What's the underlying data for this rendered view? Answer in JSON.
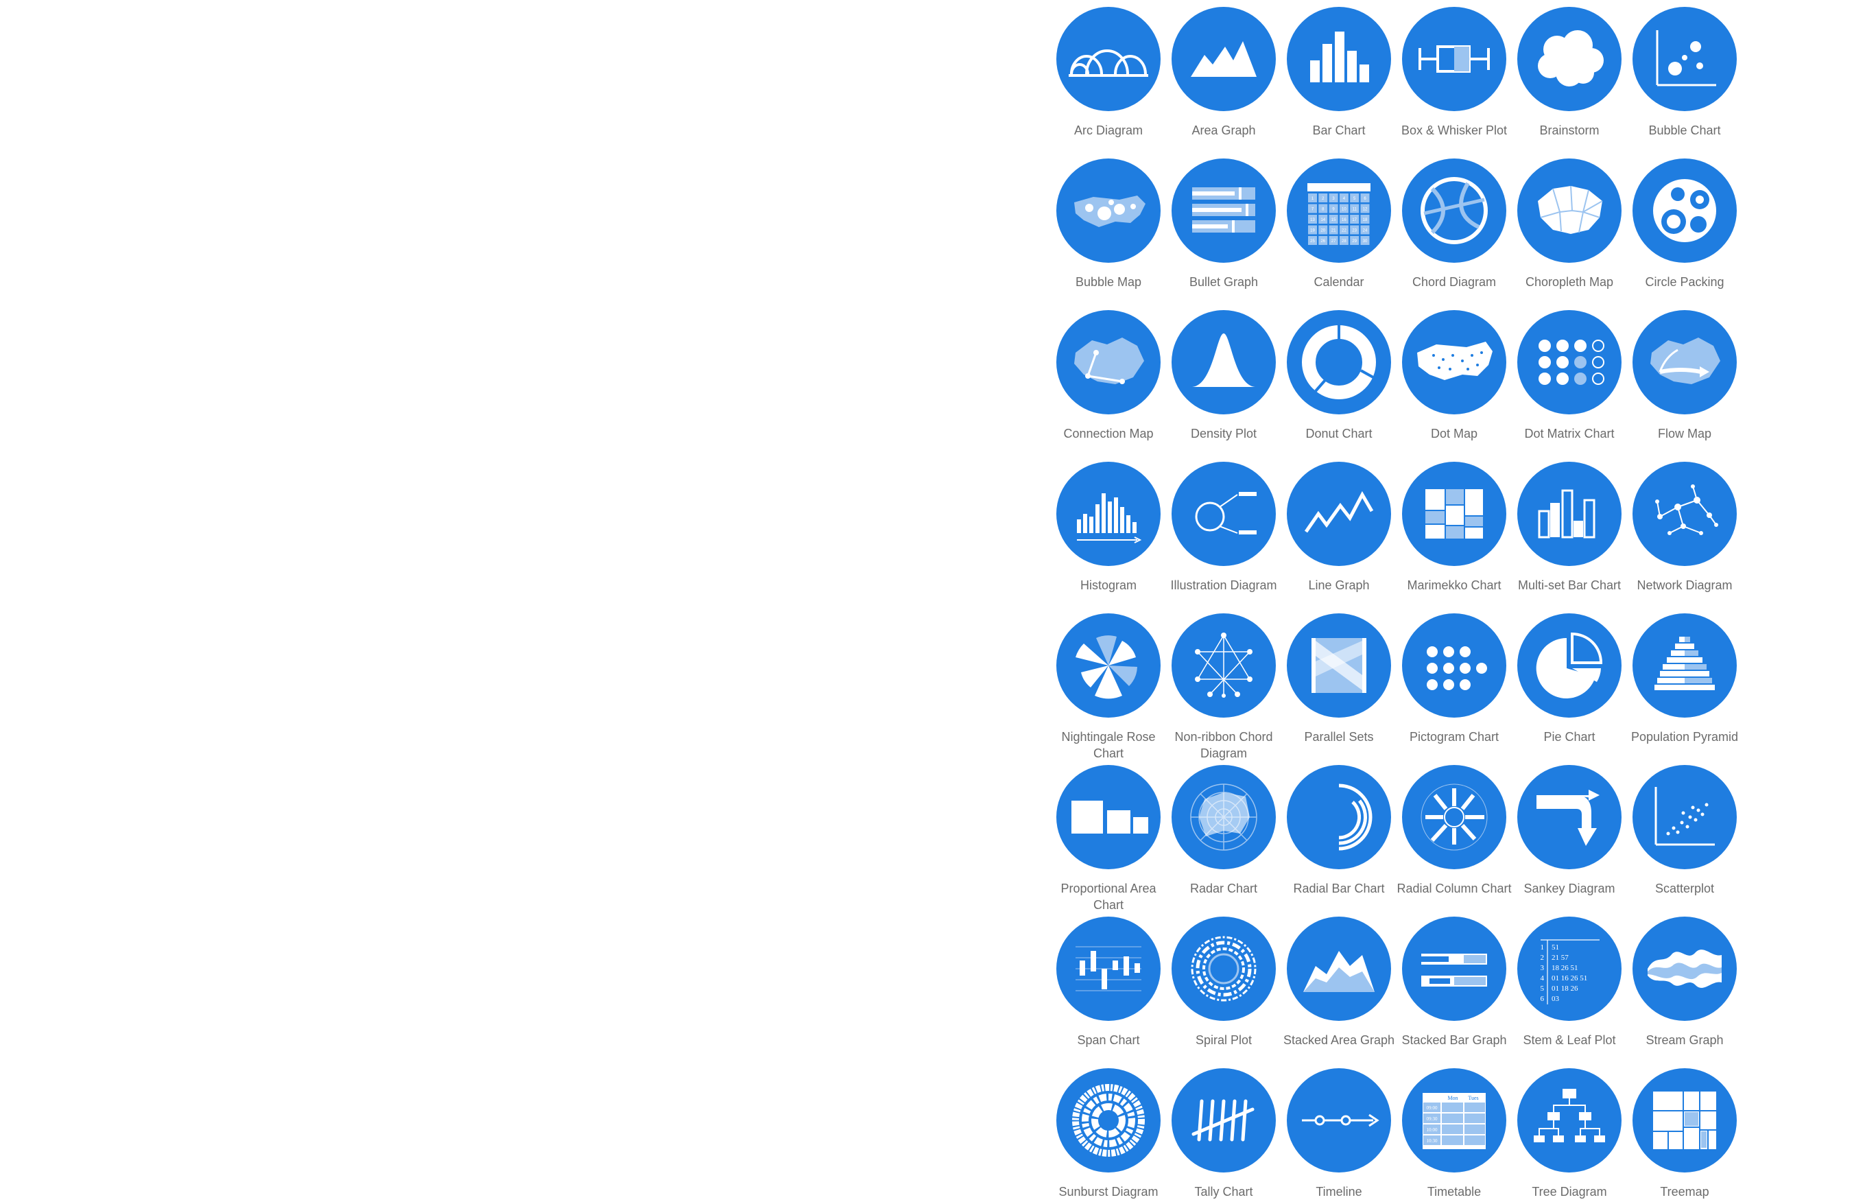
{
  "theme": {
    "circle_color": "#1f7de0",
    "label_color": "#6b6b6b",
    "background": "#ffffff"
  },
  "charts": [
    {
      "label": "Arc Diagram",
      "icon": "arc-diagram-icon"
    },
    {
      "label": "Area Graph",
      "icon": "area-graph-icon"
    },
    {
      "label": "Bar Chart",
      "icon": "bar-chart-icon"
    },
    {
      "label": "Box & Whisker Plot",
      "icon": "box-whisker-plot-icon"
    },
    {
      "label": "Brainstorm",
      "icon": "brainstorm-icon"
    },
    {
      "label": "Bubble Chart",
      "icon": "bubble-chart-icon"
    },
    {
      "label": "Bubble Map",
      "icon": "bubble-map-icon"
    },
    {
      "label": "Bullet Graph",
      "icon": "bullet-graph-icon"
    },
    {
      "label": "Calendar",
      "icon": "calendar-icon"
    },
    {
      "label": "Chord Diagram",
      "icon": "chord-diagram-icon"
    },
    {
      "label": "Choropleth Map",
      "icon": "choropleth-map-icon"
    },
    {
      "label": "Circle Packing",
      "icon": "circle-packing-icon"
    },
    {
      "label": "Connection Map",
      "icon": "connection-map-icon"
    },
    {
      "label": "Density Plot",
      "icon": "density-plot-icon"
    },
    {
      "label": "Donut Chart",
      "icon": "donut-chart-icon"
    },
    {
      "label": "Dot Map",
      "icon": "dot-map-icon"
    },
    {
      "label": "Dot Matrix Chart",
      "icon": "dot-matrix-chart-icon"
    },
    {
      "label": "Flow Map",
      "icon": "flow-map-icon"
    },
    {
      "label": "Histogram",
      "icon": "histogram-icon"
    },
    {
      "label": "Illustration Diagram",
      "icon": "illustration-diagram-icon"
    },
    {
      "label": "Line Graph",
      "icon": "line-graph-icon"
    },
    {
      "label": "Marimekko Chart",
      "icon": "marimekko-chart-icon"
    },
    {
      "label": "Multi-set Bar Chart",
      "icon": "multi-set-bar-chart-icon"
    },
    {
      "label": "Network Diagram",
      "icon": "network-diagram-icon"
    },
    {
      "label": "Nightingale Rose Chart",
      "icon": "nightingale-rose-chart-icon"
    },
    {
      "label": "Non-ribbon Chord Diagram",
      "icon": "non-ribbon-chord-diagram-icon"
    },
    {
      "label": "Parallel Sets",
      "icon": "parallel-sets-icon"
    },
    {
      "label": "Pictogram Chart",
      "icon": "pictogram-chart-icon"
    },
    {
      "label": "Pie Chart",
      "icon": "pie-chart-icon"
    },
    {
      "label": "Population Pyramid",
      "icon": "population-pyramid-icon"
    },
    {
      "label": "Proportional Area Chart",
      "icon": "proportional-area-chart-icon"
    },
    {
      "label": "Radar Chart",
      "icon": "radar-chart-icon"
    },
    {
      "label": "Radial Bar Chart",
      "icon": "radial-bar-chart-icon"
    },
    {
      "label": "Radial Column Chart",
      "icon": "radial-column-chart-icon"
    },
    {
      "label": "Sankey Diagram",
      "icon": "sankey-diagram-icon"
    },
    {
      "label": "Scatterplot",
      "icon": "scatterplot-icon"
    },
    {
      "label": "Span Chart",
      "icon": "span-chart-icon"
    },
    {
      "label": "Spiral Plot",
      "icon": "spiral-plot-icon"
    },
    {
      "label": "Stacked Area Graph",
      "icon": "stacked-area-graph-icon"
    },
    {
      "label": "Stacked Bar Graph",
      "icon": "stacked-bar-graph-icon"
    },
    {
      "label": "Stem & Leaf Plot",
      "icon": "stem-leaf-plot-icon"
    },
    {
      "label": "Stream Graph",
      "icon": "stream-graph-icon"
    },
    {
      "label": "Sunburst Diagram",
      "icon": "sunburst-diagram-icon"
    },
    {
      "label": "Tally Chart",
      "icon": "tally-chart-icon"
    },
    {
      "label": "Timeline",
      "icon": "timeline-icon"
    },
    {
      "label": "Timetable",
      "icon": "timetable-icon"
    },
    {
      "label": "Tree Diagram",
      "icon": "tree-diagram-icon"
    },
    {
      "label": "Treemap",
      "icon": "treemap-icon"
    }
  ],
  "glyph_text": {
    "calendar_numbers": [
      "1",
      "2",
      "3",
      "4",
      "5",
      "6",
      "7",
      "8",
      "9",
      "10",
      "11",
      "12",
      "13",
      "14",
      "15",
      "16",
      "17",
      "18",
      "19",
      "20",
      "21",
      "22",
      "23",
      "24",
      "25",
      "26",
      "27",
      "28",
      "29",
      "30"
    ],
    "stem_leaf_rows": [
      {
        "stem": "1",
        "leaves": "51"
      },
      {
        "stem": "2",
        "leaves": "21 57"
      },
      {
        "stem": "3",
        "leaves": "18 26 51"
      },
      {
        "stem": "4",
        "leaves": "01 16 26 51"
      },
      {
        "stem": "5",
        "leaves": "01 18 26"
      },
      {
        "stem": "6",
        "leaves": "03"
      }
    ],
    "timetable_header": [
      "Mon",
      "Tues"
    ],
    "timetable_times": [
      "09:00",
      "09:30",
      "10:00",
      "10:30"
    ]
  }
}
